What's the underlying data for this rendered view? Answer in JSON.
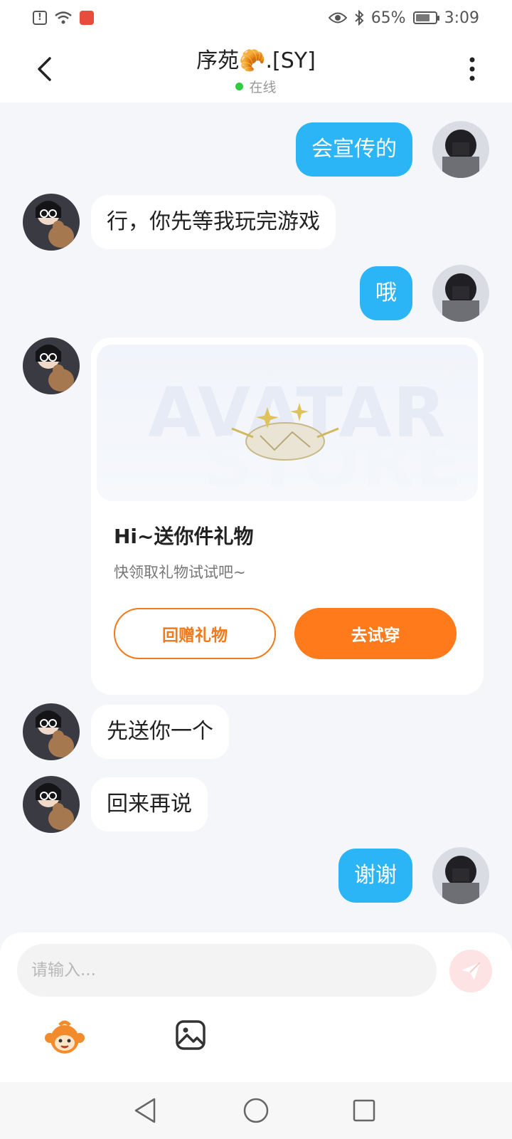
{
  "status_bar": {
    "battery": "65%",
    "battery_level": 0.65,
    "time": "3:09"
  },
  "header": {
    "title": "序苑🥐.[SY]",
    "status": "在线"
  },
  "messages": [
    {
      "side": "right",
      "text": "会宣传的"
    },
    {
      "side": "left",
      "text": "行，你先等我玩完游戏"
    },
    {
      "side": "right",
      "text": "哦"
    },
    {
      "side": "left",
      "type": "gift_card"
    },
    {
      "side": "left",
      "text": "先送你一个"
    },
    {
      "side": "left",
      "text": "回来再说"
    },
    {
      "side": "right",
      "text": "谢谢"
    }
  ],
  "gift_card": {
    "watermark_top": "AVATAR",
    "watermark_bottom": "STORE",
    "title": "Hi~送你件礼物",
    "subtitle": "快领取礼物试试吧~",
    "return_gift_label": "回赠礼物",
    "try_on_label": "去试穿"
  },
  "composer": {
    "placeholder": "请输入...",
    "value": ""
  },
  "colors": {
    "my_bubble": "#2bb5f6",
    "accent_orange": "#ff7a1a",
    "online_dot": "#2ecc40"
  },
  "icons": {
    "back": "back-arrow-icon",
    "more": "more-vertical-icon",
    "send": "send-icon",
    "mascot": "mascot-icon",
    "image": "image-icon"
  }
}
